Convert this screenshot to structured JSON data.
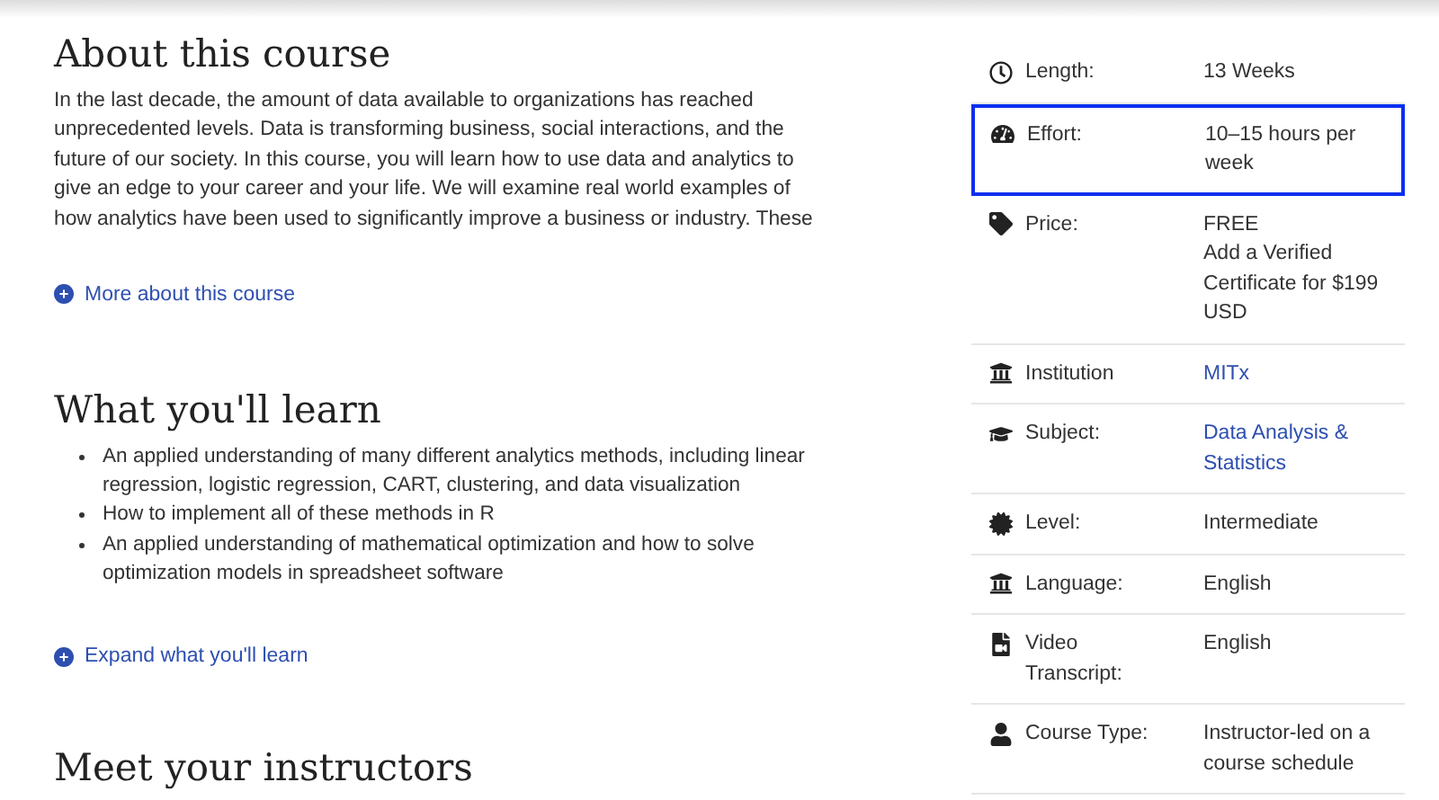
{
  "about": {
    "title": "About this course",
    "text": "In the last decade, the amount of data available to organizations has reached unprecedented levels. Data is transforming business, social interactions, and the future of our society. In this course, you will learn how to use data and analytics to give an edge to your career and your life. We will examine real world examples of how analytics have been used to significantly improve a business or industry. These",
    "more_link": "More about this course"
  },
  "learn": {
    "title": "What you'll learn",
    "items": [
      "An applied understanding of many different analytics methods, including linear regression, logistic regression, CART, clustering, and data visualization",
      "How to implement all of these methods in R",
      "An applied understanding of mathematical optimization and how to solve optimization models in spreadsheet software"
    ],
    "expand_link": "Expand what you'll learn"
  },
  "instructors": {
    "title": "Meet your instructors"
  },
  "details": [
    {
      "label": "Length:",
      "values": [
        "13 Weeks"
      ],
      "link": false,
      "highlighted": false
    },
    {
      "label": "Effort:",
      "values": [
        "10–15 hours per week"
      ],
      "link": false,
      "highlighted": true
    },
    {
      "label": "Price:",
      "values": [
        "FREE",
        "Add a Verified Certificate for $199 USD"
      ],
      "link": false,
      "highlighted": false
    },
    {
      "label": "Institution",
      "values": [
        "MITx"
      ],
      "link": true,
      "highlighted": false
    },
    {
      "label": "Subject:",
      "values": [
        "Data Analysis & Statistics"
      ],
      "link": true,
      "highlighted": false
    },
    {
      "label": "Level:",
      "values": [
        "Intermediate"
      ],
      "link": false,
      "highlighted": false
    },
    {
      "label": "Language:",
      "values": [
        "English"
      ],
      "link": false,
      "highlighted": false
    },
    {
      "label": "Video Transcript:",
      "values": [
        "English"
      ],
      "link": false,
      "highlighted": false
    },
    {
      "label": "Course Type:",
      "values": [
        "Instructor-led on a course schedule"
      ],
      "link": false,
      "highlighted": false
    }
  ]
}
